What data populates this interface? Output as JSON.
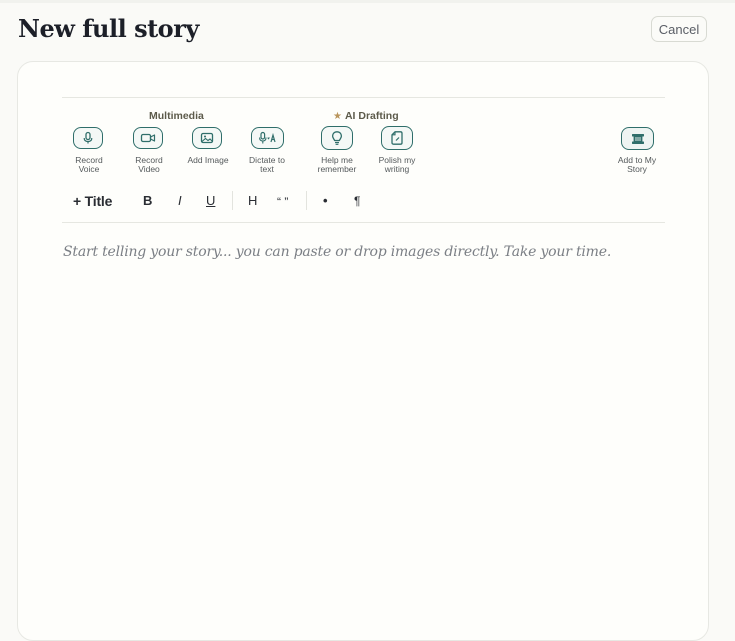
{
  "header": {
    "title": "New full story",
    "cancel_label": "Cancel"
  },
  "toolbar": {
    "groups": {
      "multimedia": "Multimedia",
      "ai_drafting": "AI Drafting"
    },
    "tools": [
      {
        "label": "Record\nVoice",
        "icon": "microphone-icon"
      },
      {
        "label": "Record\nVideo",
        "icon": "video-camera-icon"
      },
      {
        "label": "Add Image",
        "icon": "image-icon"
      },
      {
        "label": "Dictate to\ntext",
        "icon": "dictate-icon"
      },
      {
        "label": "Help me\nremember",
        "icon": "lightbulb-icon"
      },
      {
        "label": "Polish my\nwriting",
        "icon": "polish-document-icon"
      },
      {
        "label": "Add to My\nStory",
        "icon": "book-add-icon"
      }
    ],
    "format": {
      "title": "+ Title",
      "bold": "B",
      "italic": "I",
      "underline": "U",
      "heading": "H",
      "quote": "“ ”",
      "bullet": "•",
      "paragraph": "¶"
    }
  },
  "editor": {
    "placeholder": "Start telling your story... you can paste or drop images directly. Take your time."
  },
  "colors": {
    "accent": "#2f6e6a",
    "star": "#b9955c",
    "background": "#fafaf7"
  }
}
